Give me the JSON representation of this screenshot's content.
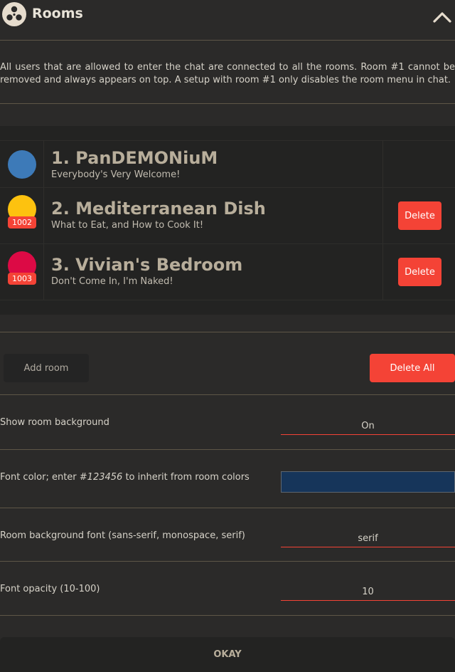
{
  "header": {
    "title": "Rooms",
    "logo_icon": "film-reel-icon",
    "collapse_icon": "chevron-up-icon"
  },
  "description": "All users that are allowed to enter the chat are connected to all the rooms. Room #1 cannot be removed and always appears on top. A setup with room #1 only disables the room menu in chat.",
  "rooms": [
    {
      "name": "1. PanDEMONiuM",
      "subtitle": "Everybody's Very Welcome!",
      "color": "#3d7ab8",
      "id": "",
      "delete_label": ""
    },
    {
      "name": "2. Mediterranean Dish",
      "subtitle": "What to Eat, and How to Cook It!",
      "color": "#fdc20f",
      "id": "1002",
      "delete_label": "Delete"
    },
    {
      "name": "3. Vivian's Bedroom",
      "subtitle": "Don't Come In, I'm Naked!",
      "color": "#dc0a45",
      "id": "1003",
      "delete_label": "Delete"
    }
  ],
  "actions": {
    "add_room": "Add room",
    "delete_all": "Delete All"
  },
  "settings": {
    "show_background": {
      "label": "Show room background",
      "value": "On"
    },
    "font_color": {
      "label_prefix": "Font color; enter ",
      "label_code": "#123456",
      "label_suffix": " to inherit from room colors",
      "value_color": "#16355a"
    },
    "background_font": {
      "label": "Room background font (sans-serif, monospace, serif)",
      "value": "serif"
    },
    "font_opacity": {
      "label": "Font opacity (10-100)",
      "value": "10"
    }
  },
  "footer": {
    "okay": "OKAY"
  },
  "colors": {
    "accent": "#f44336",
    "divider": "#5e5647"
  }
}
